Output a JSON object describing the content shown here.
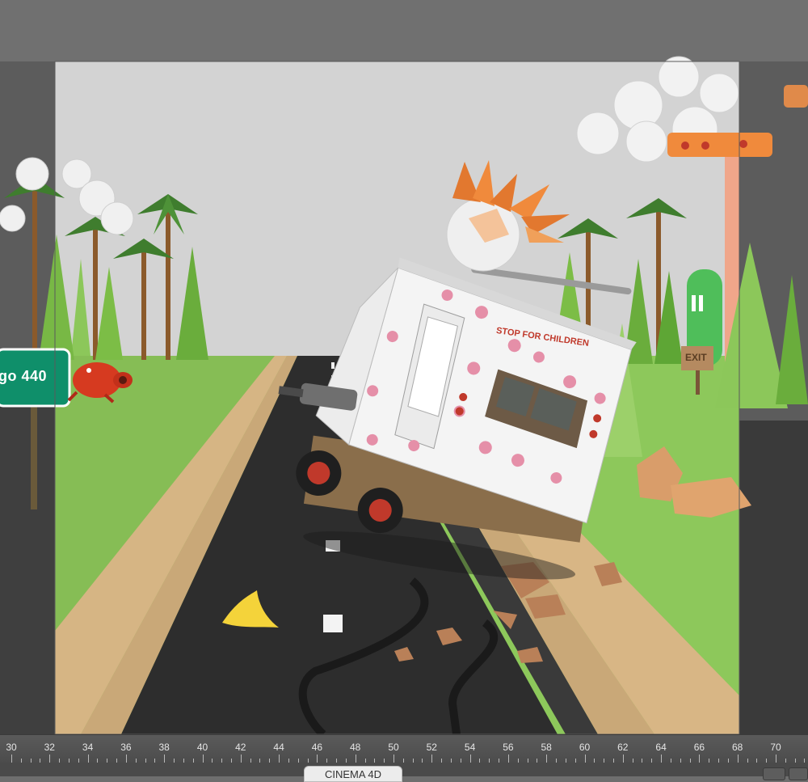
{
  "road_sign": {
    "text": "go   440"
  },
  "truck": {
    "label": "STOP FOR CHILDREN"
  },
  "exit_sign": {
    "text": "EXIT"
  },
  "timeline": {
    "frame_labels": [
      "30",
      "32",
      "34",
      "36",
      "38",
      "40",
      "42",
      "44",
      "46",
      "48",
      "50",
      "52",
      "54",
      "56",
      "58",
      "60",
      "62",
      "64",
      "66",
      "68",
      "70"
    ]
  },
  "render_tab": {
    "label": "CINEMA 4D"
  },
  "colors": {
    "sky": "#d3d3d3",
    "grass": "#8cc35a",
    "road": "#2d2d2d",
    "sign_green": "#0f8f6a",
    "truck_dot": "#e58fa8"
  }
}
